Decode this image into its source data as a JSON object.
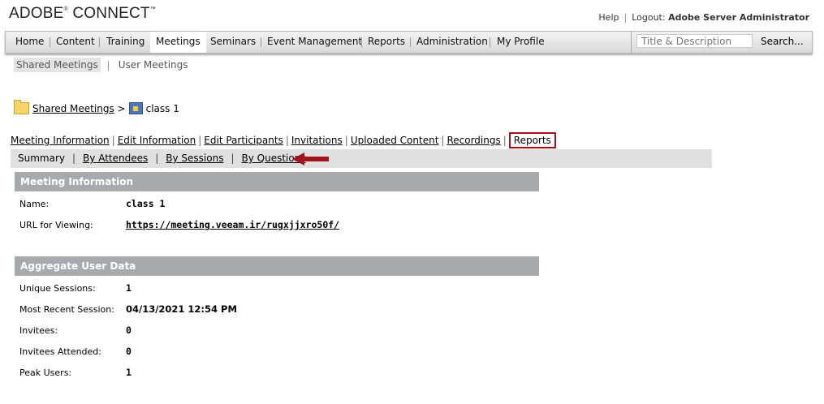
{
  "brand": {
    "name": "ADOBE",
    "reg": "®",
    "product": "CONNECT",
    "tm": "™"
  },
  "top_links": {
    "help": "Help",
    "logout_prefix": "Logout:",
    "user": "Adobe Server Administrator"
  },
  "nav": {
    "items": [
      "Home",
      "Content",
      "Training",
      "Meetings",
      "Seminars",
      "Event Management",
      "Reports",
      "Administration",
      "My Profile"
    ],
    "active": "Meetings",
    "search_placeholder": "Title & Description",
    "search_button": "Search..."
  },
  "subnav": {
    "items": [
      "Shared Meetings",
      "User Meetings"
    ],
    "active": "Shared Meetings"
  },
  "breadcrumb": {
    "folder": "Shared Meetings",
    "separator": ">",
    "current": "class 1"
  },
  "meeting_tabs": [
    "Meeting Information",
    "Edit Information",
    "Edit Participants",
    "Invitations",
    "Uploaded Content",
    "Recordings",
    "Reports"
  ],
  "report_tabs": [
    "Summary",
    "By Attendees",
    "By Sessions",
    "By Questions"
  ],
  "meeting_info": {
    "heading": "Meeting Information",
    "name_label": "Name:",
    "name_value": "class 1",
    "url_label": "URL for Viewing:",
    "url_value": "https://meeting.veeam.ir/rugxjjxro50f/"
  },
  "aggregate": {
    "heading": "Aggregate User Data",
    "rows": [
      {
        "label": "Unique Sessions:",
        "value": "1"
      },
      {
        "label": "Most Recent Session:",
        "value": "04/13/2021 12:54 PM"
      },
      {
        "label": "Invitees:",
        "value": "0"
      },
      {
        "label": "Invitees Attended:",
        "value": "0"
      },
      {
        "label": "Peak Users:",
        "value": "1"
      }
    ]
  },
  "colors": {
    "highlight": "#a3141a",
    "section_header": "#a7a9ac",
    "report_bar": "#e0e0e0"
  },
  "icons": {
    "folder": "folder-icon",
    "meeting": "meeting-icon",
    "arrow": "left-arrow-icon"
  }
}
